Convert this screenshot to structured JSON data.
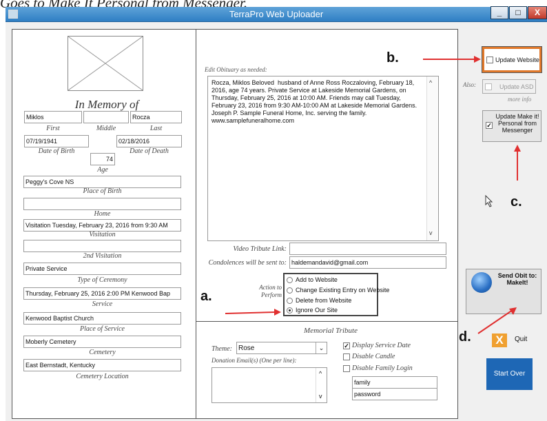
{
  "caption": "Goes to Make It Personal from Messenger.",
  "window": {
    "title": "TerraPro Web Uploader",
    "min": "_",
    "max": "□",
    "close": "X"
  },
  "memory": {
    "heading": "In Memory of"
  },
  "fields": {
    "first": {
      "value": "Miklos",
      "label": "First"
    },
    "middle": {
      "value": "",
      "label": "Middle"
    },
    "last": {
      "value": "Rocza",
      "label": "Last"
    },
    "dob": {
      "value": "07/19/1941",
      "label": "Date of Birth"
    },
    "dod": {
      "value": "02/18/2016",
      "label": "Date of Death"
    },
    "age": {
      "value": "74",
      "label": "Age"
    },
    "place_of_birth": {
      "value": "Peggy's Cove NS",
      "label": "Place of Birth"
    },
    "home": {
      "value": "",
      "label": "Home"
    },
    "visitation": {
      "value": "Visitation Tuesday, February 23, 2016 from 9:30 AM",
      "label": "Visitation"
    },
    "visitation2": {
      "value": "",
      "label": "2nd Visitation"
    },
    "ceremony": {
      "value": "Private Service",
      "label": "Type of Ceremony"
    },
    "service": {
      "value": "Thursday, February 25, 2016 2:00 PM Kenwood Bap",
      "label": "Service"
    },
    "place_of_service": {
      "value": "Kenwood Baptist Church",
      "label": "Place of Service"
    },
    "cemetery": {
      "value": "Moberly Cemetery",
      "label": "Cemetery"
    },
    "cemetery_location": {
      "value": "East Bernstadt, Kentucky",
      "label": "Cemetery Location"
    }
  },
  "obituary": {
    "label": "Edit Obituary as needed:",
    "text": "Rocza, Miklos Beloved  husband of Anne Ross Roczaloving, February 18, 2016, age 74 years. Private Service at Lakeside Memorial Gardens, on Thursday, February 25, 2016 at 10:00 AM. Friends may call Tuesday, February 23, 2016 from 9:30 AM-10:00 AM at Lakeside Memorial Gardens.\nJoseph P. Sample Funeral Home, Inc. serving the family.\nwww.samplefuneralhome.com",
    "scroll_up": "^",
    "scroll_down": "v"
  },
  "video": {
    "label": "Video Tribute Link:",
    "value": ""
  },
  "condolences": {
    "label": "Condolences will be sent to:",
    "value": "haldemandavid@gmail.com"
  },
  "action": {
    "label": "Action to Perform",
    "options": [
      "Add to Website",
      "Change Existing Entry on Website",
      "Delete from Website",
      "Ignore Our Site"
    ],
    "selected_index": 3
  },
  "tribute": {
    "heading": "Memorial Tribute",
    "theme_label": "Theme:",
    "theme_value": "Rose",
    "donation_label": "Donation Email(s) (One per line):",
    "display_service_date": "Display Service Date",
    "disable_candle": "Disable Candle",
    "disable_family_login": "Disable Family Login",
    "login_user": "family",
    "login_pass": "password"
  },
  "side": {
    "update_website": "Update Website",
    "also": "Also:",
    "update_asd": "Update ASD",
    "more_info": "more info",
    "make_it_personal": "Update Make it! Personal from Messenger",
    "send_obit": "Send Obit to: MakeIt!",
    "quit": "Quit",
    "start_over": "Start Over",
    "quit_icon": "X"
  },
  "annotations": {
    "a": "a.",
    "b": "b.",
    "c": "c.",
    "d": "d."
  },
  "colors": {
    "titlebar": "#2f7fc4",
    "arrow": "#e03030",
    "start_over": "#1e67b5",
    "quit": "#f0a030",
    "update_website_border": "#e0782a"
  }
}
